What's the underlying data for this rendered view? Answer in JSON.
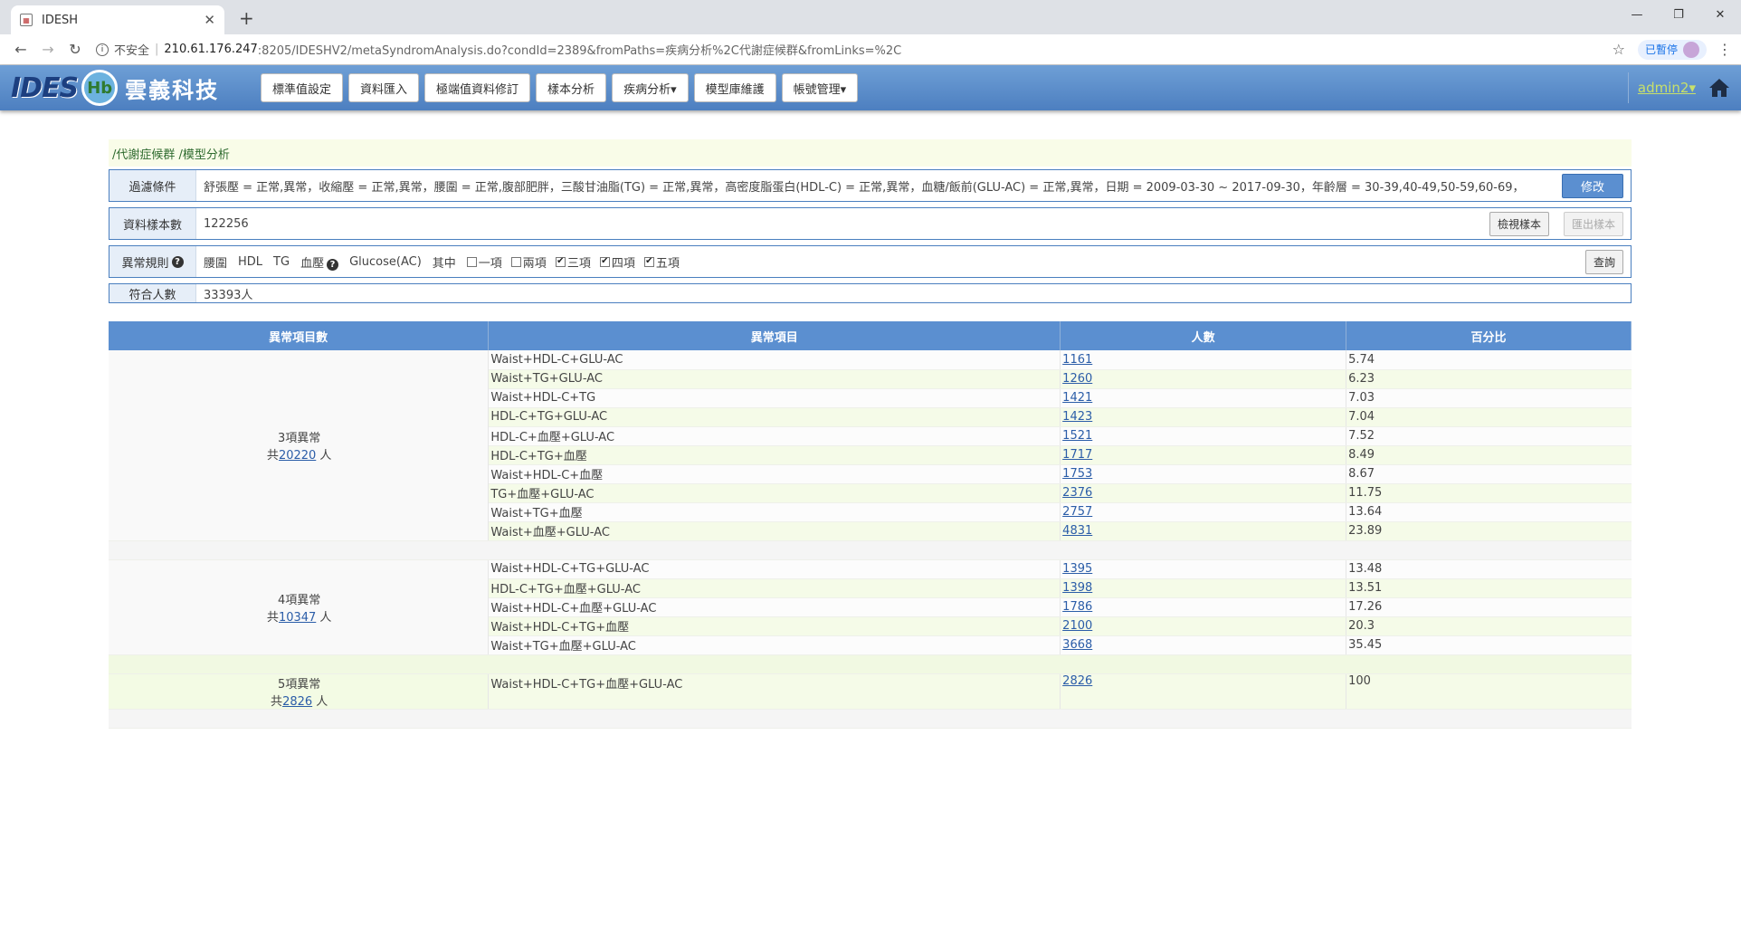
{
  "browser": {
    "tab_title": "IDESH",
    "new_tab": "+",
    "insecure": "不安全",
    "url_host": "210.61.176.247",
    "url_rest": ":8205/IDESHV2/metaSyndromAnalysis.do?condId=2389&fromPaths=疾病分析%2C代謝症候群&fromLinks=%2C",
    "paused": "已暫停"
  },
  "app": {
    "logo_text": "IDES",
    "logo_badge": "Hb",
    "company": "雲義科技",
    "nav": [
      "標準值設定",
      "資料匯入",
      "極端值資料修訂",
      "樣本分析",
      "疾病分析▾",
      "模型庫維護",
      "帳號管理▾"
    ],
    "user": "admin2▾"
  },
  "breadcrumb": "/代謝症候群 /模型分析",
  "filter": {
    "label": "過濾條件",
    "value": "舒張壓 = 正常,異常，收縮壓 = 正常,異常，腰圍 = 正常,腹部肥胖，三酸甘油脂(TG) = 正常,異常，高密度脂蛋白(HDL-C) = 正常,異常，血糖/飯前(GLU-AC) = 正常,異常，日期 = 2009-03-30 ~ 2017-09-30，年齡層 = 30-39,40-49,50-59,60-69，",
    "edit_btn": "修改"
  },
  "samples": {
    "label": "資料樣本數",
    "value": "122256",
    "view_btn": "檢視樣本",
    "export_btn": "匯出樣本"
  },
  "rules": {
    "label": "異常規則",
    "items": [
      "腰圍",
      "HDL",
      "TG",
      "血壓",
      "Glucose(AC)"
    ],
    "among": "其中",
    "checks": [
      {
        "label": "一項",
        "checked": false
      },
      {
        "label": "兩項",
        "checked": false
      },
      {
        "label": "三項",
        "checked": true
      },
      {
        "label": "四項",
        "checked": true
      },
      {
        "label": "五項",
        "checked": true
      }
    ],
    "query_btn": "查詢"
  },
  "match": {
    "label": "符合人數",
    "value": "33393人"
  },
  "table": {
    "headers": [
      "異常項目數",
      "異常項目",
      "人數",
      "百分比"
    ],
    "groups": [
      {
        "title": "3項異常",
        "total_prefix": "共",
        "total": "20220",
        "total_suffix": " 人",
        "rows": [
          {
            "item": "Waist+HDL-C+GLU-AC",
            "count": "1161",
            "pct": "5.74"
          },
          {
            "item": "Waist+TG+GLU-AC",
            "count": "1260",
            "pct": "6.23"
          },
          {
            "item": "Waist+HDL-C+TG",
            "count": "1421",
            "pct": "7.03"
          },
          {
            "item": "HDL-C+TG+GLU-AC",
            "count": "1423",
            "pct": "7.04"
          },
          {
            "item": "HDL-C+血壓+GLU-AC",
            "count": "1521",
            "pct": "7.52"
          },
          {
            "item": "HDL-C+TG+血壓",
            "count": "1717",
            "pct": "8.49"
          },
          {
            "item": "Waist+HDL-C+血壓",
            "count": "1753",
            "pct": "8.67"
          },
          {
            "item": "TG+血壓+GLU-AC",
            "count": "2376",
            "pct": "11.75"
          },
          {
            "item": "Waist+TG+血壓",
            "count": "2757",
            "pct": "13.64"
          },
          {
            "item": "Waist+血壓+GLU-AC",
            "count": "4831",
            "pct": "23.89"
          }
        ]
      },
      {
        "title": "4項異常",
        "total_prefix": "共",
        "total": "10347",
        "total_suffix": " 人",
        "rows": [
          {
            "item": "Waist+HDL-C+TG+GLU-AC",
            "count": "1395",
            "pct": "13.48"
          },
          {
            "item": "HDL-C+TG+血壓+GLU-AC",
            "count": "1398",
            "pct": "13.51"
          },
          {
            "item": "Waist+HDL-C+血壓+GLU-AC",
            "count": "1786",
            "pct": "17.26"
          },
          {
            "item": "Waist+HDL-C+TG+血壓",
            "count": "2100",
            "pct": "20.3"
          },
          {
            "item": "Waist+TG+血壓+GLU-AC",
            "count": "3668",
            "pct": "35.45"
          }
        ]
      },
      {
        "title": "5項異常",
        "total_prefix": "共",
        "total": "2826",
        "total_suffix": " 人",
        "rows": [
          {
            "item": "Waist+HDL-C+TG+血壓+GLU-AC",
            "count": "2826",
            "pct": "100"
          }
        ]
      }
    ]
  }
}
